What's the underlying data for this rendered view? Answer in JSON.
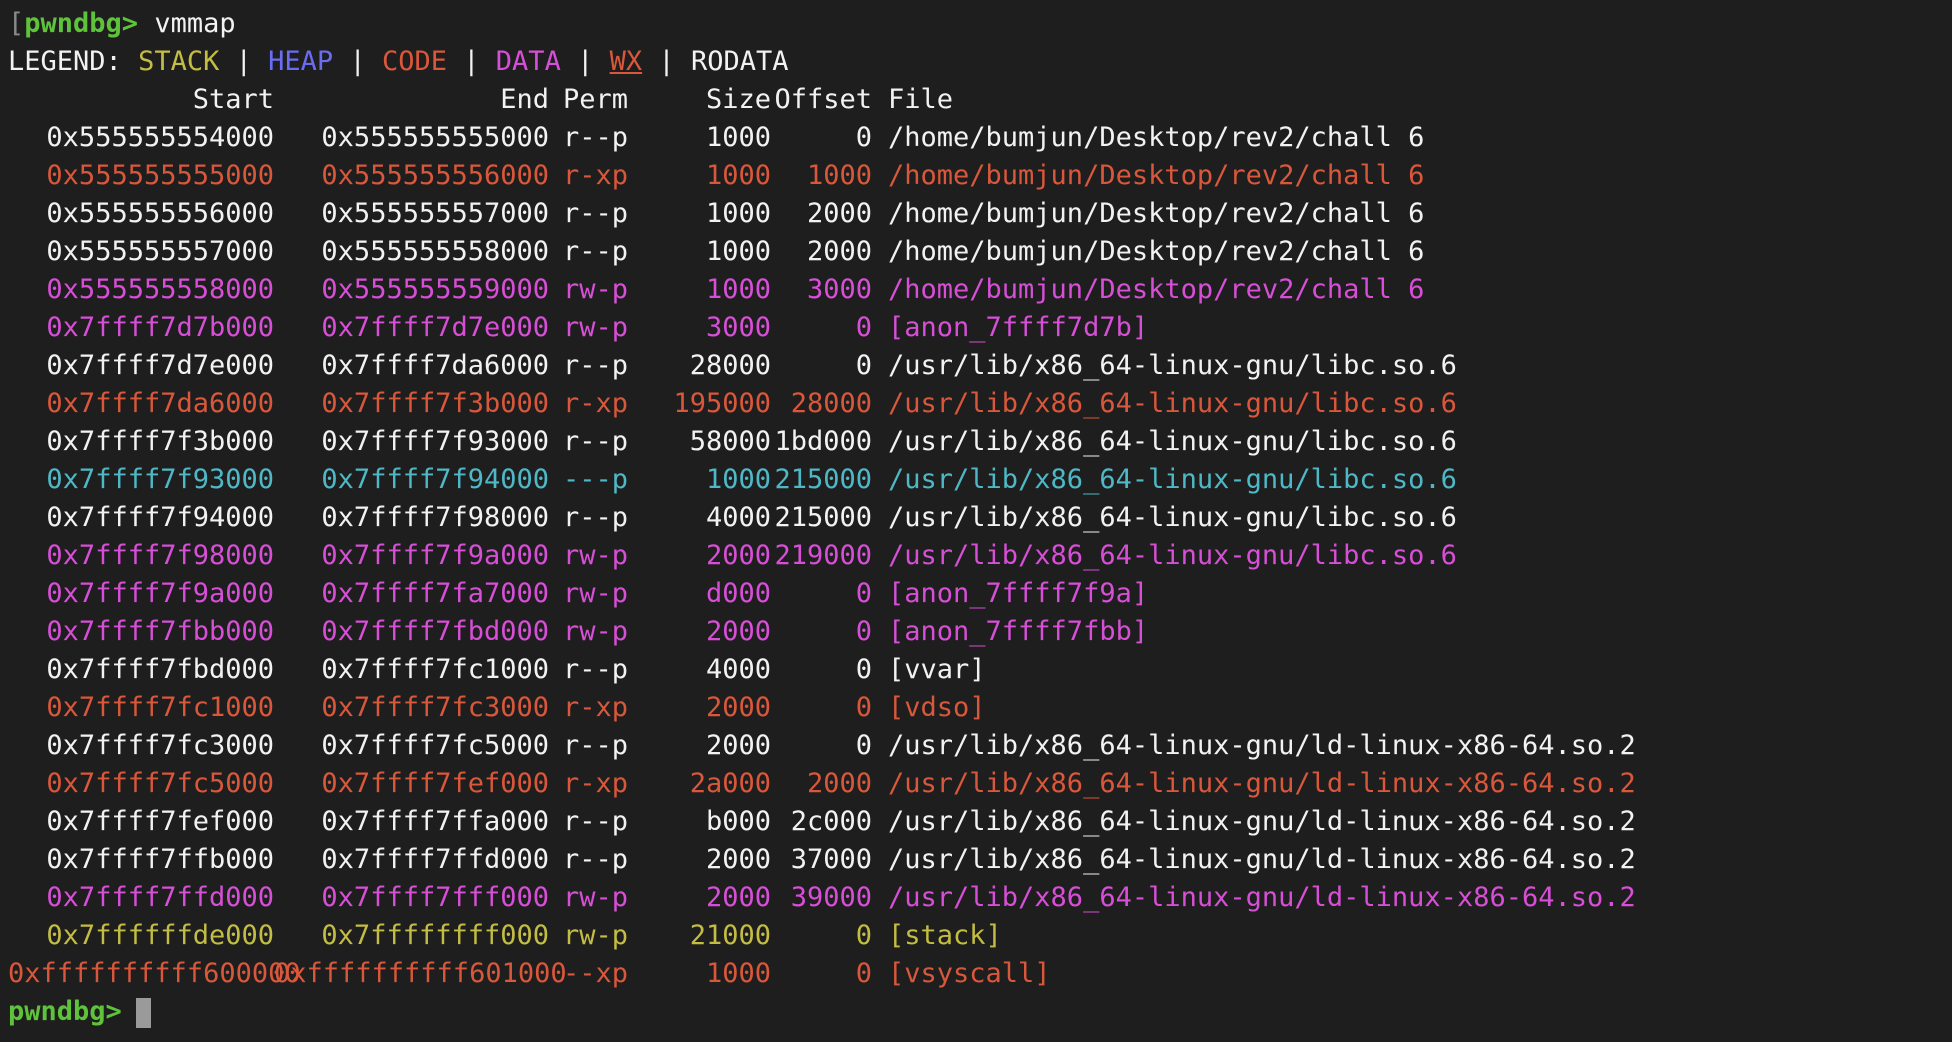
{
  "colors": {
    "stack": "#c3bd43",
    "heap": "#6a6cf3",
    "code": "#d9573a",
    "data": "#d64fd6",
    "rodata": "#f2f2f2",
    "guard": "#4fb8c6",
    "prompt": "#5fc23b",
    "background": "#1e1e1e"
  },
  "prompt": "pwndbg>",
  "command": "vmmap",
  "legend": {
    "label": "LEGEND:",
    "separator": "|",
    "stack": "STACK",
    "heap": "HEAP",
    "code": "CODE",
    "data": "DATA",
    "wx": "WX",
    "rodata": "RODATA"
  },
  "headers": {
    "start": "Start",
    "end": "End",
    "perm": "Perm",
    "size": "Size",
    "offset": "Offset",
    "file": "File"
  },
  "rows": [
    {
      "start": "0x555555554000",
      "end": "0x555555555000",
      "perm": "r--p",
      "size": "1000",
      "offset": "0",
      "file": "/home/bumjun/Desktop/rev2/chall 6",
      "kind": "rodata"
    },
    {
      "start": "0x555555555000",
      "end": "0x555555556000",
      "perm": "r-xp",
      "size": "1000",
      "offset": "1000",
      "file": "/home/bumjun/Desktop/rev2/chall 6",
      "kind": "code"
    },
    {
      "start": "0x555555556000",
      "end": "0x555555557000",
      "perm": "r--p",
      "size": "1000",
      "offset": "2000",
      "file": "/home/bumjun/Desktop/rev2/chall 6",
      "kind": "rodata"
    },
    {
      "start": "0x555555557000",
      "end": "0x555555558000",
      "perm": "r--p",
      "size": "1000",
      "offset": "2000",
      "file": "/home/bumjun/Desktop/rev2/chall 6",
      "kind": "rodata"
    },
    {
      "start": "0x555555558000",
      "end": "0x555555559000",
      "perm": "rw-p",
      "size": "1000",
      "offset": "3000",
      "file": "/home/bumjun/Desktop/rev2/chall 6",
      "kind": "data"
    },
    {
      "start": "0x7ffff7d7b000",
      "end": "0x7ffff7d7e000",
      "perm": "rw-p",
      "size": "3000",
      "offset": "0",
      "file": "[anon_7ffff7d7b]",
      "kind": "data"
    },
    {
      "start": "0x7ffff7d7e000",
      "end": "0x7ffff7da6000",
      "perm": "r--p",
      "size": "28000",
      "offset": "0",
      "file": "/usr/lib/x86_64-linux-gnu/libc.so.6",
      "kind": "rodata"
    },
    {
      "start": "0x7ffff7da6000",
      "end": "0x7ffff7f3b000",
      "perm": "r-xp",
      "size": "195000",
      "offset": "28000",
      "file": "/usr/lib/x86_64-linux-gnu/libc.so.6",
      "kind": "code"
    },
    {
      "start": "0x7ffff7f3b000",
      "end": "0x7ffff7f93000",
      "perm": "r--p",
      "size": "58000",
      "offset": "1bd000",
      "file": "/usr/lib/x86_64-linux-gnu/libc.so.6",
      "kind": "rodata"
    },
    {
      "start": "0x7ffff7f93000",
      "end": "0x7ffff7f94000",
      "perm": "---p",
      "size": "1000",
      "offset": "215000",
      "file": "/usr/lib/x86_64-linux-gnu/libc.so.6",
      "kind": "guard"
    },
    {
      "start": "0x7ffff7f94000",
      "end": "0x7ffff7f98000",
      "perm": "r--p",
      "size": "4000",
      "offset": "215000",
      "file": "/usr/lib/x86_64-linux-gnu/libc.so.6",
      "kind": "rodata"
    },
    {
      "start": "0x7ffff7f98000",
      "end": "0x7ffff7f9a000",
      "perm": "rw-p",
      "size": "2000",
      "offset": "219000",
      "file": "/usr/lib/x86_64-linux-gnu/libc.so.6",
      "kind": "data"
    },
    {
      "start": "0x7ffff7f9a000",
      "end": "0x7ffff7fa7000",
      "perm": "rw-p",
      "size": "d000",
      "offset": "0",
      "file": "[anon_7ffff7f9a]",
      "kind": "data"
    },
    {
      "start": "0x7ffff7fbb000",
      "end": "0x7ffff7fbd000",
      "perm": "rw-p",
      "size": "2000",
      "offset": "0",
      "file": "[anon_7ffff7fbb]",
      "kind": "data"
    },
    {
      "start": "0x7ffff7fbd000",
      "end": "0x7ffff7fc1000",
      "perm": "r--p",
      "size": "4000",
      "offset": "0",
      "file": "[vvar]",
      "kind": "rodata"
    },
    {
      "start": "0x7ffff7fc1000",
      "end": "0x7ffff7fc3000",
      "perm": "r-xp",
      "size": "2000",
      "offset": "0",
      "file": "[vdso]",
      "kind": "code"
    },
    {
      "start": "0x7ffff7fc3000",
      "end": "0x7ffff7fc5000",
      "perm": "r--p",
      "size": "2000",
      "offset": "0",
      "file": "/usr/lib/x86_64-linux-gnu/ld-linux-x86-64.so.2",
      "kind": "rodata"
    },
    {
      "start": "0x7ffff7fc5000",
      "end": "0x7ffff7fef000",
      "perm": "r-xp",
      "size": "2a000",
      "offset": "2000",
      "file": "/usr/lib/x86_64-linux-gnu/ld-linux-x86-64.so.2",
      "kind": "code"
    },
    {
      "start": "0x7ffff7fef000",
      "end": "0x7ffff7ffa000",
      "perm": "r--p",
      "size": "b000",
      "offset": "2c000",
      "file": "/usr/lib/x86_64-linux-gnu/ld-linux-x86-64.so.2",
      "kind": "rodata"
    },
    {
      "start": "0x7ffff7ffb000",
      "end": "0x7ffff7ffd000",
      "perm": "r--p",
      "size": "2000",
      "offset": "37000",
      "file": "/usr/lib/x86_64-linux-gnu/ld-linux-x86-64.so.2",
      "kind": "rodata"
    },
    {
      "start": "0x7ffff7ffd000",
      "end": "0x7ffff7fff000",
      "perm": "rw-p",
      "size": "2000",
      "offset": "39000",
      "file": "/usr/lib/x86_64-linux-gnu/ld-linux-x86-64.so.2",
      "kind": "data"
    },
    {
      "start": "0x7ffffffde000",
      "end": "0x7ffffffff000",
      "perm": "rw-p",
      "size": "21000",
      "offset": "0",
      "file": "[stack]",
      "kind": "stack"
    },
    {
      "start": "0xffffffffff600000",
      "end": "0xffffffffff601000",
      "perm": "--xp",
      "size": "1000",
      "offset": "0",
      "file": "[vsyscall]",
      "kind": "code"
    }
  ]
}
